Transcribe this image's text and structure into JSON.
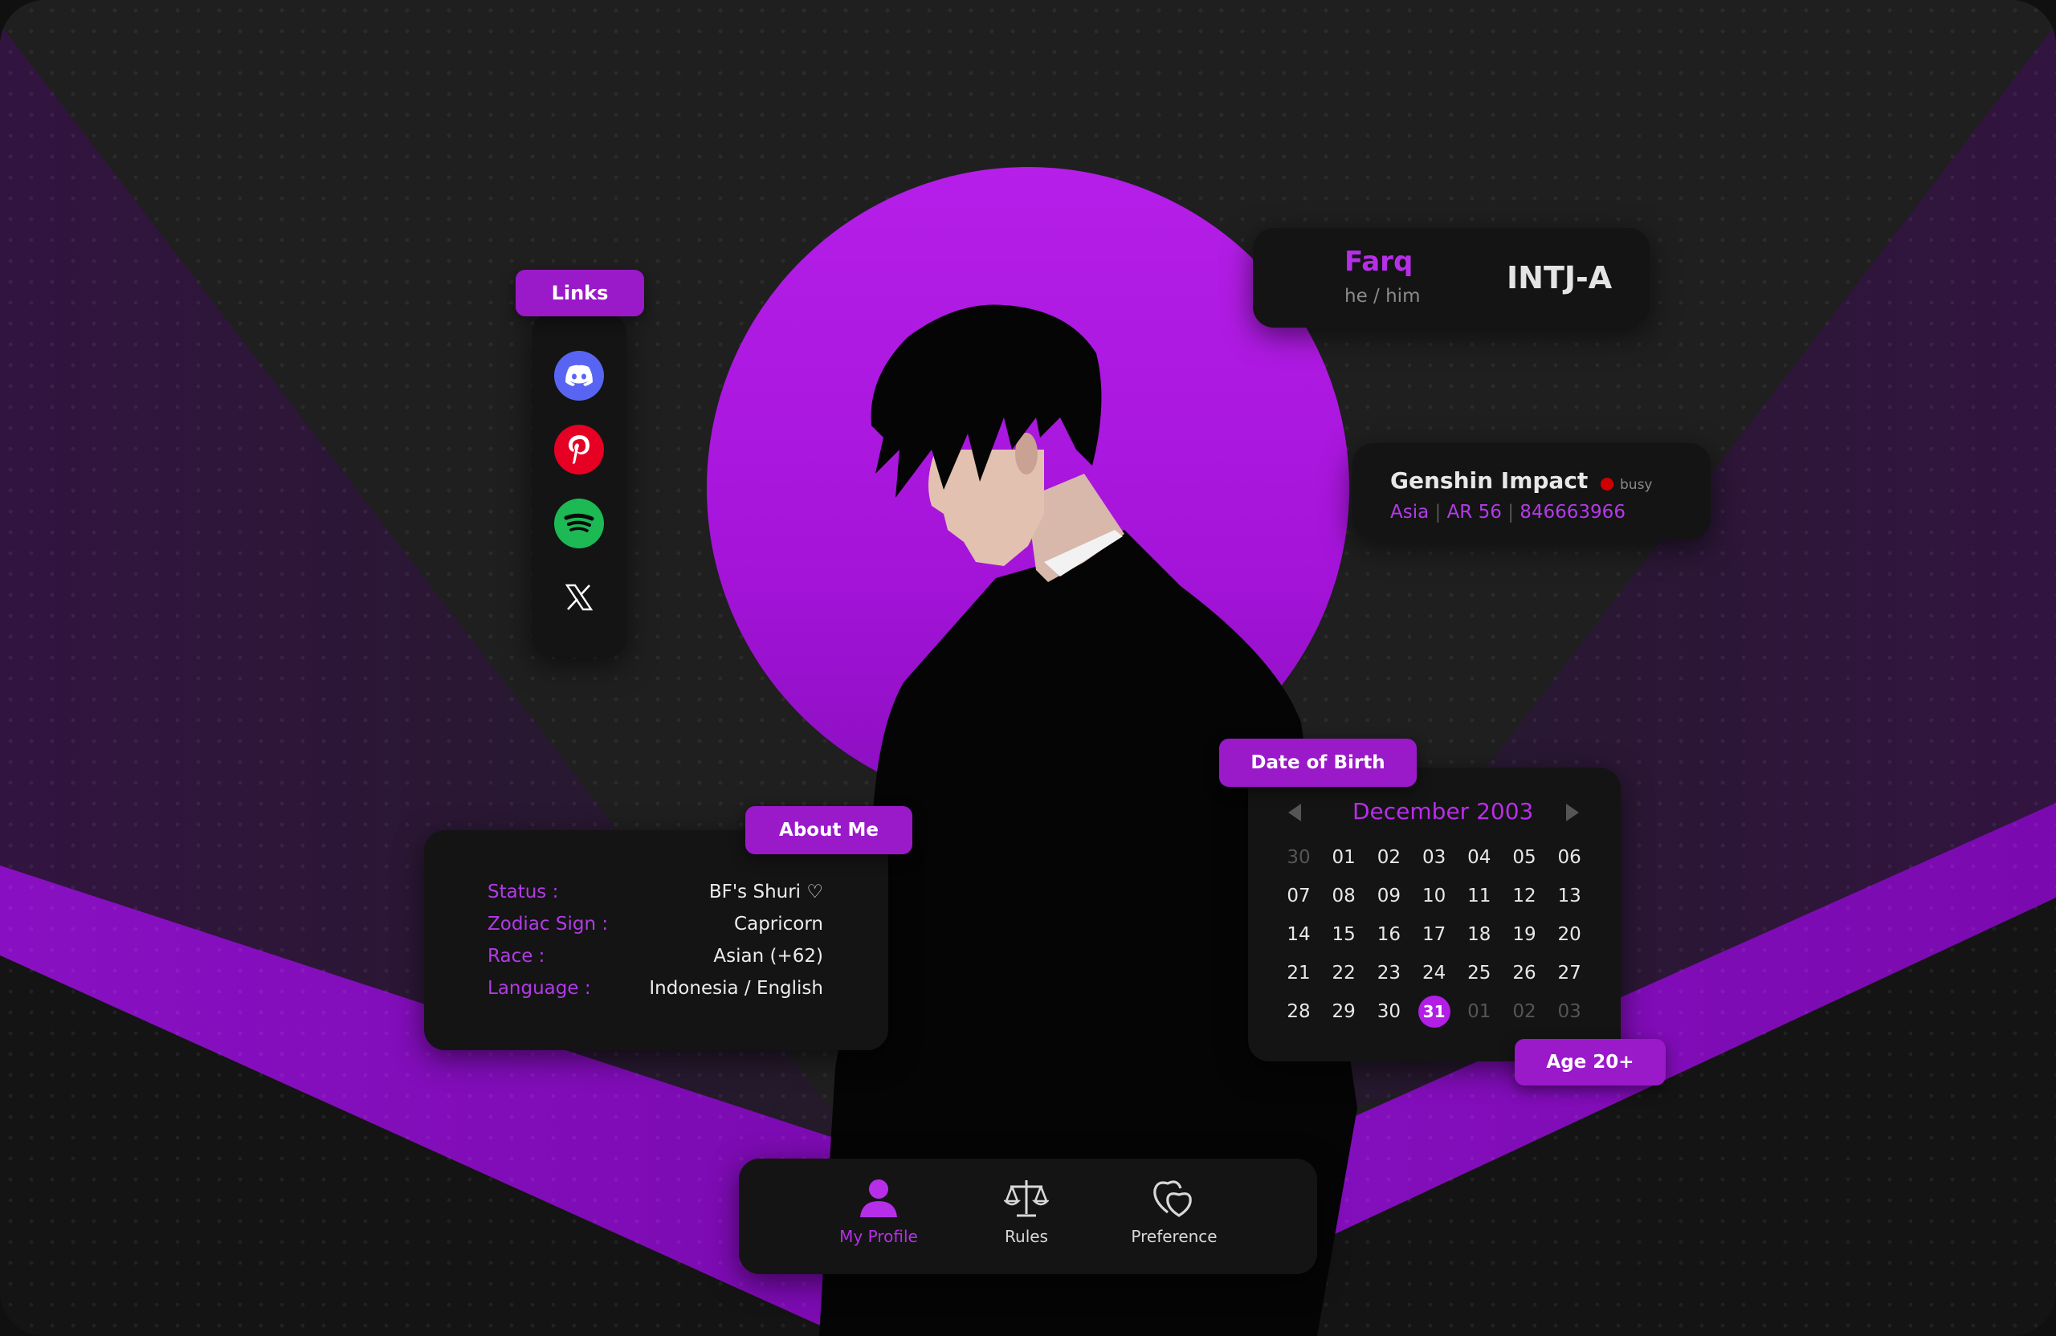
{
  "links": {
    "title": "Links",
    "items": [
      {
        "name": "Discord",
        "icon": "discord-icon",
        "color": "#5865F2"
      },
      {
        "name": "Pinterest",
        "icon": "pinterest-icon",
        "color": "#E60023"
      },
      {
        "name": "Spotify",
        "icon": "spotify-icon",
        "color": "#1DB954"
      },
      {
        "name": "X",
        "icon": "x-icon",
        "color": "#ffffff"
      }
    ]
  },
  "profile": {
    "name": "Farq",
    "pronouns": "he / him",
    "mbti": "INTJ-A"
  },
  "game": {
    "title": "Genshin Impact",
    "status": "busy",
    "status_color": "#d00000",
    "region": "Asia",
    "sep1": "|",
    "rank": "AR 56",
    "sep2": "|",
    "uid": "846663966"
  },
  "about": {
    "title": "About Me",
    "rows": [
      {
        "label": "Status :",
        "value": "BF's Shuri ♡"
      },
      {
        "label": "Zodiac Sign :",
        "value": "Capricorn"
      },
      {
        "label": "Race :",
        "value": "Asian (+62)"
      },
      {
        "label": "Language :",
        "value": "Indonesia / English"
      }
    ]
  },
  "dob": {
    "title": "Date of Birth",
    "month": "December 2003",
    "days": [
      [
        "30",
        "01",
        "02",
        "03",
        "04",
        "05",
        "06"
      ],
      [
        "07",
        "08",
        "09",
        "10",
        "11",
        "12",
        "13"
      ],
      [
        "14",
        "15",
        "16",
        "17",
        "18",
        "19",
        "20"
      ],
      [
        "21",
        "22",
        "23",
        "24",
        "25",
        "26",
        "27"
      ],
      [
        "28",
        "29",
        "30",
        "31",
        "01",
        "02",
        "03"
      ]
    ],
    "selected": "31",
    "age": "Age 20+"
  },
  "nav": {
    "items": [
      {
        "label": "My Profile",
        "icon": "user-icon",
        "active": true
      },
      {
        "label": "Rules",
        "icon": "scales-icon",
        "active": false
      },
      {
        "label": "Preference",
        "icon": "hearts-icon",
        "active": false
      }
    ]
  },
  "colors": {
    "accent": "#b21ee6",
    "accent_dark": "#7a00b4",
    "panel": "#141414",
    "background": "#1f1f1f"
  }
}
